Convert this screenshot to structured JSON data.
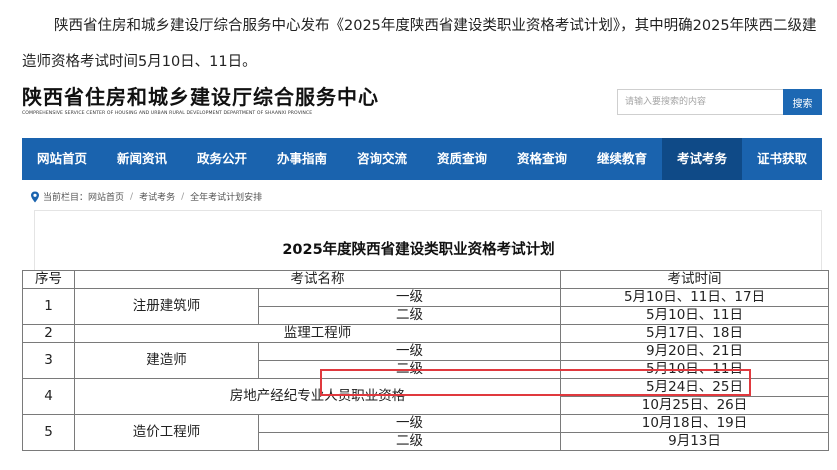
{
  "intro": "陕西省住房和城乡建设厅综合服务中心发布《2025年度陕西省建设类职业资格考试计划》，其中明确2025年陕西二级建造师资格考试时间5月10日、11日。",
  "site": {
    "logo_cn": "陕西省住房和城乡建设厅综合服务中心",
    "logo_en": "COMPREHENSIVE SERVICE CENTER OF HOUSING AND URBAN RURAL DEVELOPMENT DEPARTMENT OF SHAANXI PROVINCE"
  },
  "search": {
    "placeholder": "请输入要搜索的内容",
    "button": "搜索"
  },
  "nav": [
    "网站首页",
    "新闻资讯",
    "政务公开",
    "办事指南",
    "咨询交流",
    "资质查询",
    "资格查询",
    "继续教育",
    "考试考务",
    "证书获取"
  ],
  "breadcrumb": {
    "label": "当前栏目：",
    "items": [
      "网站首页",
      "考试考务",
      "全年考试计划安排"
    ]
  },
  "title": "2025年度陕西省建设类职业资格考试计划",
  "table": {
    "headers": {
      "no": "序号",
      "name": "考试名称",
      "time": "考试时间"
    },
    "r1": {
      "no": "1",
      "name": "注册建筑师",
      "sub1": "一级",
      "time1": "5月10日、11日、17日",
      "sub2": "二级",
      "time2": "5月10日、11日"
    },
    "r2": {
      "no": "2",
      "name": "监理工程师",
      "time": "5月17日、18日"
    },
    "r3": {
      "no": "3",
      "name": "建造师",
      "sub1": "一级",
      "time1": "9月20日、21日",
      "sub2": "二级",
      "time2": "5月10日、11日"
    },
    "r4": {
      "no": "4",
      "name": "房地产经纪专业人员职业资格",
      "time1": "5月24日、25日",
      "time2": "10月25日、26日"
    },
    "r5": {
      "no": "5",
      "name": "造价工程师",
      "sub1": "一级",
      "time1": "10月18日、19日",
      "sub2": "二级",
      "time2": "9月13日"
    }
  },
  "colors": {
    "nav": "#1a63ae",
    "nav_active": "#0f4a87",
    "highlight": "#e0393e"
  }
}
